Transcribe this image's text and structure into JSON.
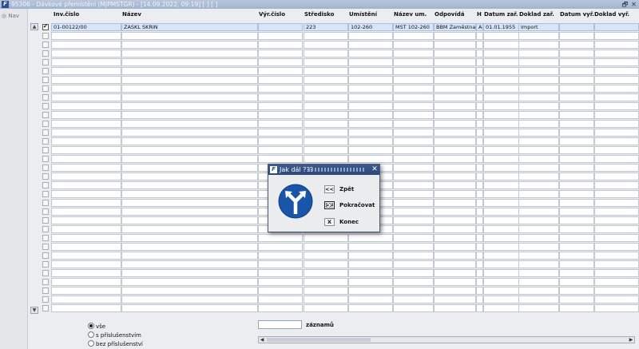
{
  "window": {
    "title": "95306 - Dávkové přemístění (MJPMSTGR) - [14.09.2022, 09:19]  [ ] [ ]",
    "restore_glyph": "🗗",
    "close_glyph": "✕"
  },
  "sidebar": {
    "nav_label": "Nav",
    "nav_icon": "◎"
  },
  "grid": {
    "columns": [
      "Inv.číslo",
      "Název",
      "Výr.číslo",
      "Středisko",
      "Umístění",
      "Název um.",
      "Odpovídá",
      "H",
      "Datum zař.",
      "Doklad zař.",
      "Datum vyř.",
      "Doklad vyř."
    ],
    "rows": [
      [
        "01-00122/00",
        "ZASKL SKRIN",
        "",
        "223",
        "102-260",
        "MST 102-260",
        "BBM Zaměstnanec",
        "A",
        "01.01.1955",
        "Import",
        "",
        ""
      ]
    ],
    "first_row_checked": true,
    "scroll_up": "▲",
    "scroll_down": "▼"
  },
  "filter": {
    "options": [
      "vše",
      "s příslušenstvím",
      "bez příslušenství"
    ],
    "selected": "vše"
  },
  "footer": {
    "count_label": "záznamů",
    "count_value": ""
  },
  "hscroll": {
    "left": "◀",
    "right": "▶"
  },
  "dialog": {
    "title": "Jak dál ???",
    "close": "✕",
    "buttons": [
      {
        "key": "<<",
        "label": "Zpět"
      },
      {
        "key": ">>",
        "label": "Pokračovat"
      },
      {
        "key": "X",
        "label": "Konec"
      }
    ]
  },
  "colors": {
    "titlebar": "#a9bad4",
    "dialog_title": "#2f4c80",
    "selected_row": "#d6e6f8",
    "sign_blue": "#1a56a8"
  }
}
